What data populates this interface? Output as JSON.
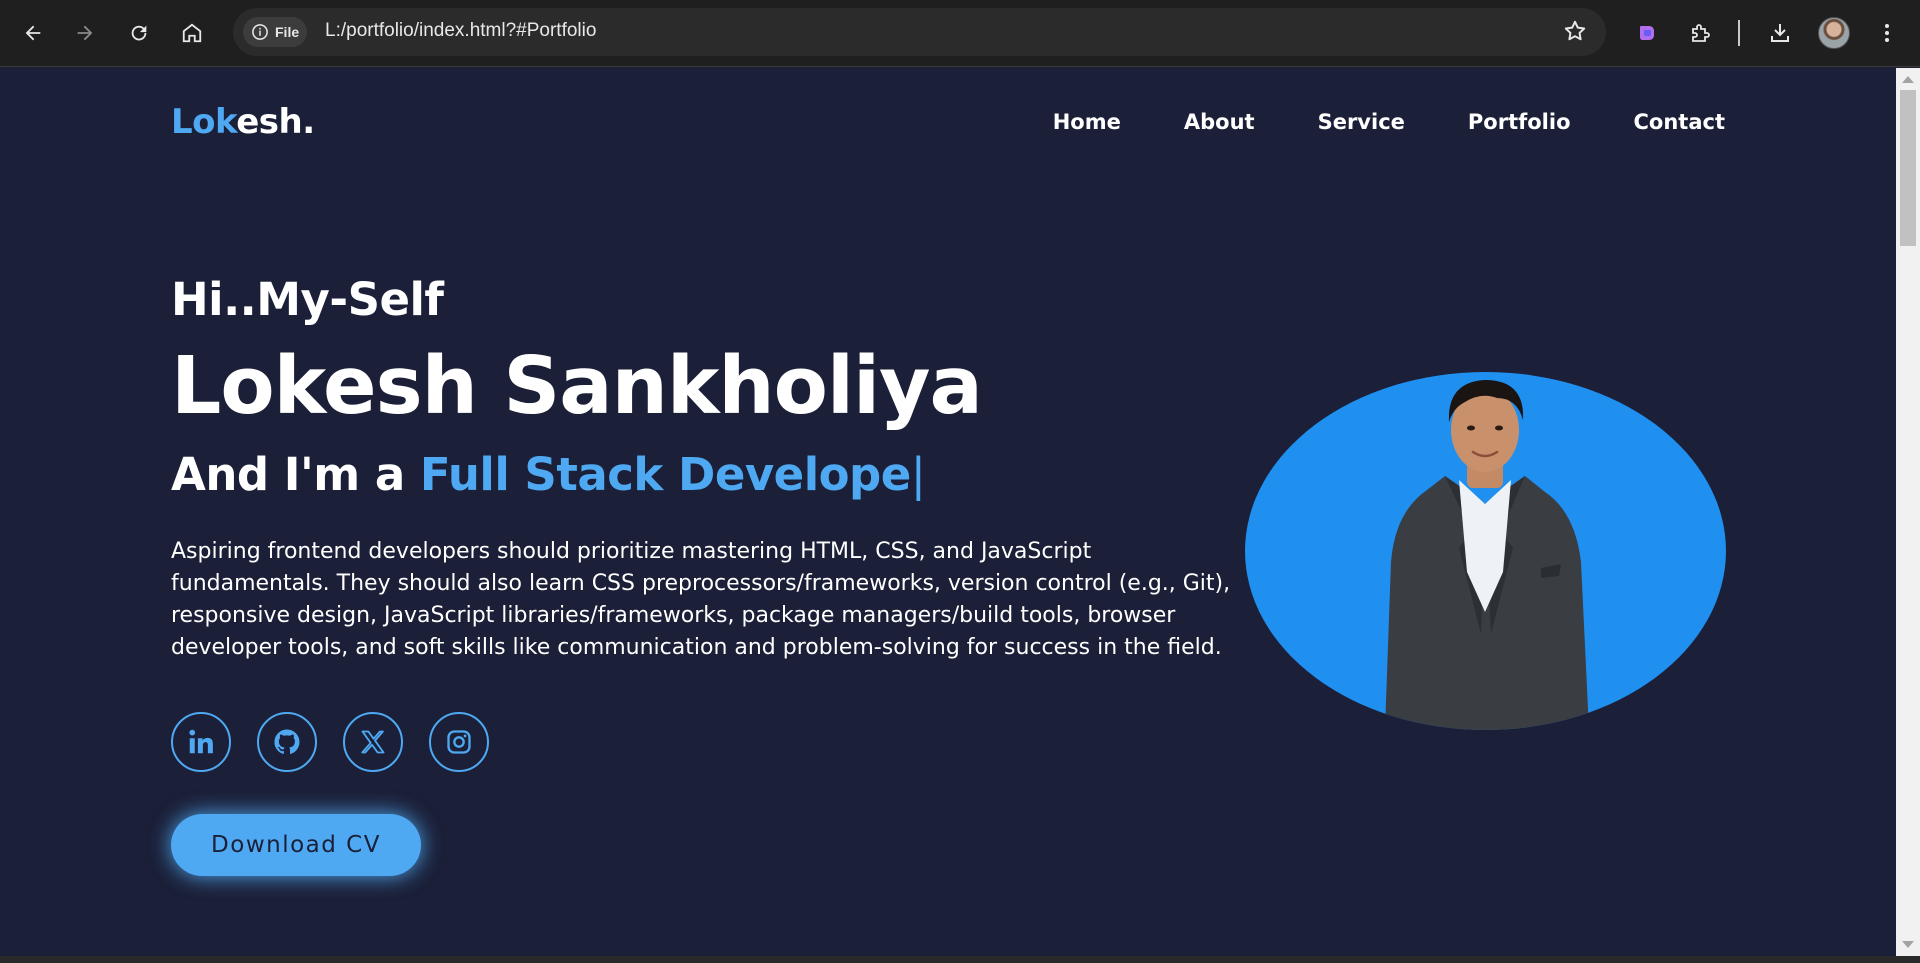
{
  "browser": {
    "site_chip_label": "File",
    "url": "L:/portfolio/index.html?#Portfolio",
    "icons": [
      "back-icon",
      "forward-icon",
      "reload-icon",
      "home-icon",
      "info-icon",
      "star-icon",
      "copilot-icon",
      "extensions-icon",
      "download-icon",
      "profile-avatar",
      "more-icon"
    ]
  },
  "header": {
    "logo_accent": "Lok",
    "logo_rest": "esh.",
    "nav": [
      "Home",
      "About",
      "Service",
      "Portfolio",
      "Contact"
    ]
  },
  "hero": {
    "greeting": "Hi..My-Self",
    "name": "Lokesh Sankholiya",
    "role_prefix": "And I'm a ",
    "role_typed": "Full Stack Develope",
    "role_caret": "|",
    "description": "Aspiring frontend developers should prioritize mastering HTML, CSS, and JavaScript fundamentals. They should also learn CSS preprocessors/frameworks, version control (e.g., Git), responsive design, JavaScript libraries/frameworks, package managers/build tools, browser developer tools, and soft skills like communication and problem-solving for success in the field.",
    "socials": [
      "linkedin-icon",
      "github-icon",
      "x-twitter-icon",
      "instagram-icon"
    ],
    "cta_label": "Download CV"
  },
  "colors": {
    "background": "#1b1f37",
    "accent": "#4ea9f2",
    "photo_bg": "#1f8ff0",
    "text": "#ffffff"
  }
}
